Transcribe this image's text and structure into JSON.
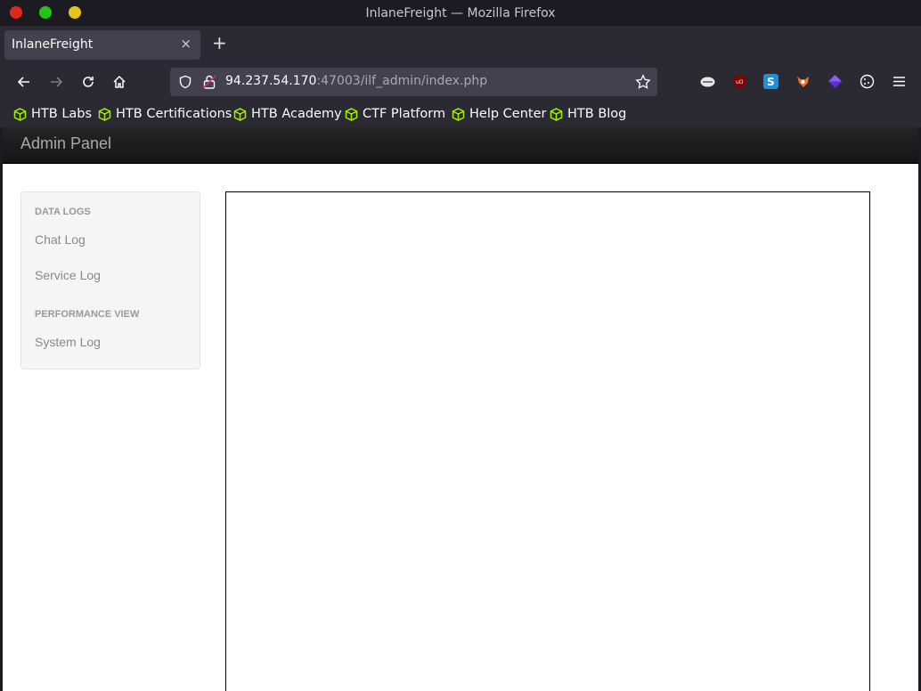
{
  "window": {
    "title": "InlaneFreight — Mozilla Firefox"
  },
  "tab": {
    "label": "InlaneFreight",
    "close": "×",
    "new_tab": "+"
  },
  "urlbar": {
    "host": "94.237.54.170",
    "rest": ":47003/ilf_admin/index.php"
  },
  "bookmarks": [
    {
      "label": "HTB Labs"
    },
    {
      "label": "HTB Certifications"
    },
    {
      "label": "HTB Academy"
    },
    {
      "label": "CTF Platform"
    },
    {
      "label": "Help Center"
    },
    {
      "label": "HTB Blog"
    }
  ],
  "page": {
    "brand": "Admin Panel",
    "sidebar": {
      "section1": "DATA LOGS",
      "link1": "Chat Log",
      "link2": "Service Log",
      "section2": "PERFORMANCE VIEW",
      "link3": "System Log"
    }
  },
  "colors": {
    "bookmark_icon": "#9fef00",
    "header_bg": "#1b1b1b"
  }
}
